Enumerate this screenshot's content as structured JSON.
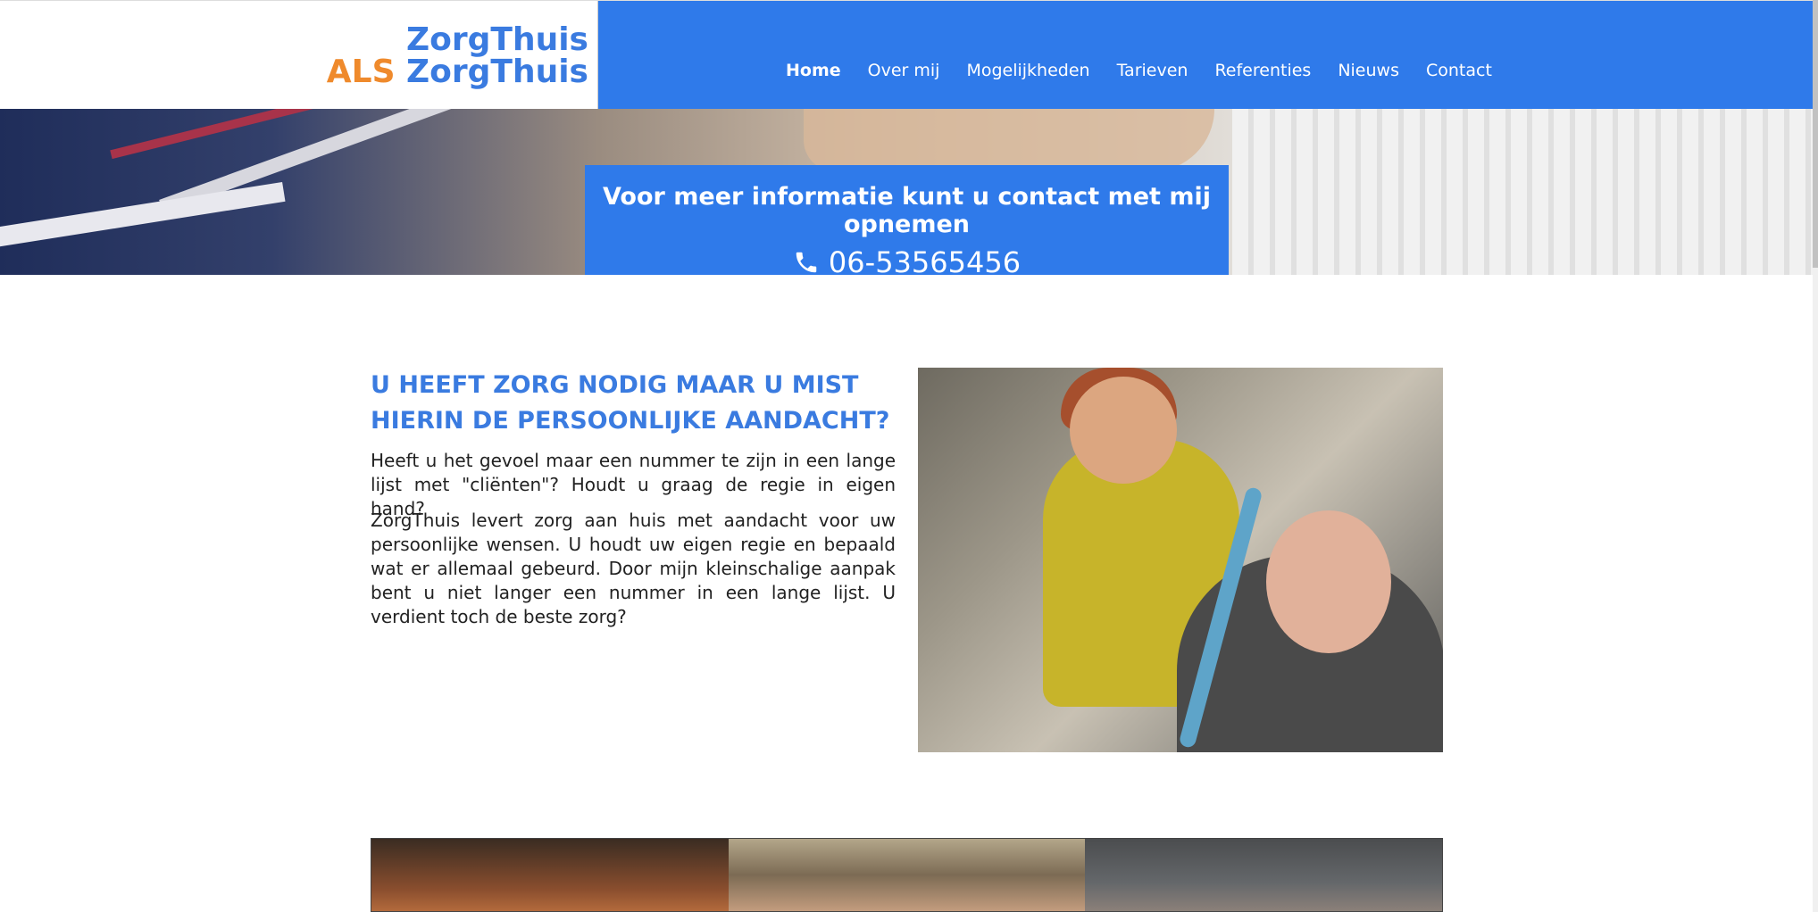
{
  "logo": {
    "line1": "ZorgThuis",
    "line2_prefix": "ALS",
    "line2_suffix": "ZorgThuis"
  },
  "nav": {
    "items": [
      {
        "label": "Home",
        "active": true
      },
      {
        "label": "Over mij"
      },
      {
        "label": "Mogelijkheden"
      },
      {
        "label": "Tarieven"
      },
      {
        "label": "Referenties"
      },
      {
        "label": "Nieuws"
      },
      {
        "label": "Contact"
      }
    ]
  },
  "hero": {
    "info_text": "Voor meer informatie kunt u contact met mij opnemen",
    "phone": "06-53565456",
    "phone_icon": "phone-icon"
  },
  "main": {
    "title_line1": "U HEEFT ZORG NODIG MAAR U MIST",
    "title_line2": "HIERIN DE PERSOONLIJKE AANDACHT?",
    "paragraph1": "Heeft u het gevoel maar een nummer te zijn in een lange lijst met \"cliënten\"? Houdt u graag de regie in eigen hand?",
    "paragraph2": "ZorgThuis levert zorg aan huis met aandacht voor uw persoonlijke wensen. U houdt uw eigen regie en bepaald wat er allemaal gebeurd. Door mijn kleinschalige aanpak bent u niet langer een nummer in een lange lijst. U verdient toch de beste zorg?"
  },
  "colors": {
    "brand_blue": "#2f7aea",
    "title_blue": "#3a7be0",
    "logo_orange": "#ef8a2c"
  }
}
